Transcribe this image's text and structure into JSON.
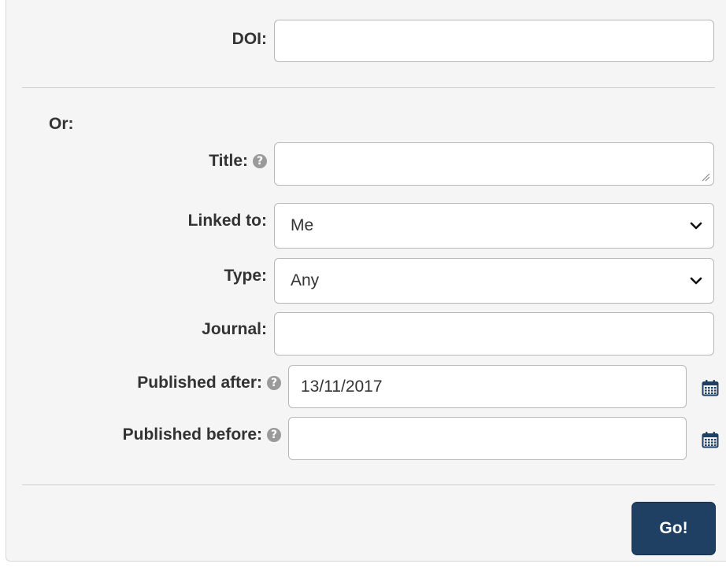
{
  "doi": {
    "label": "DOI:",
    "value": ""
  },
  "or_label": "Or:",
  "title_field": {
    "label": "Title:",
    "value": ""
  },
  "linked_to": {
    "label": "Linked to:",
    "selected": "Me"
  },
  "type_field": {
    "label": "Type:",
    "selected": "Any"
  },
  "journal": {
    "label": "Journal:",
    "value": ""
  },
  "published_after": {
    "label": "Published after:",
    "value": "13/11/2017"
  },
  "published_before": {
    "label": "Published before:",
    "value": ""
  },
  "help_glyph": "?",
  "submit": {
    "label": "Go!"
  },
  "colors": {
    "button": "#1f3f63",
    "calendar": "#1f3f63",
    "help": "#9a9a9a"
  },
  "icons": [
    "help-icon",
    "calendar-icon",
    "chevron-down-icon",
    "resize-grip-icon"
  ]
}
